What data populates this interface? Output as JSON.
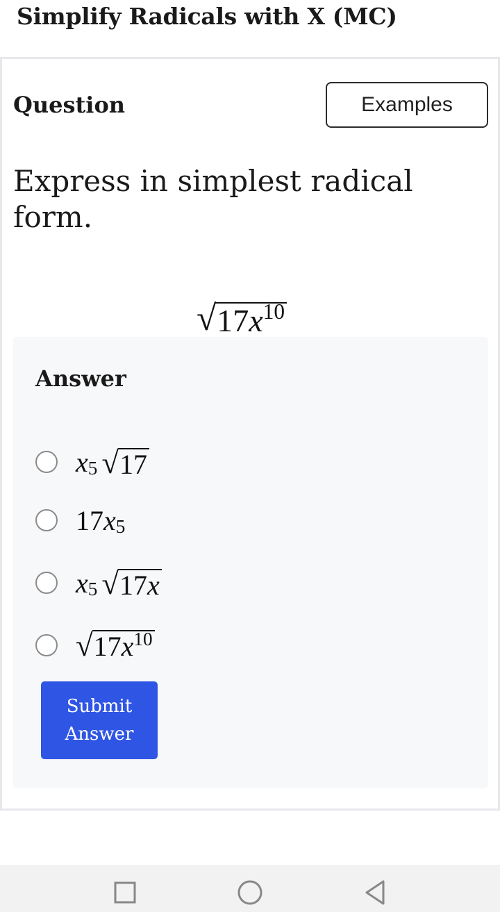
{
  "header": {
    "title": "Simplify Radicals with X (MC)"
  },
  "question": {
    "label": "Question",
    "examples_label": "Examples",
    "prompt": "Express in simplest radical form.",
    "expression": {
      "radicand_coef": "17",
      "radicand_var": "x",
      "radicand_exp": "10"
    }
  },
  "answer": {
    "label": "Answer",
    "options": [
      {
        "outer_var": "x",
        "outer_exp": "5",
        "radicand_coef": "17",
        "radicand_var": "",
        "radicand_exp": ""
      },
      {
        "coef": "17",
        "var": "x",
        "exp": "5"
      },
      {
        "outer_var": "x",
        "outer_exp": "5",
        "radicand_coef": "17",
        "radicand_var": "x",
        "radicand_exp": ""
      },
      {
        "radicand_coef": "17",
        "radicand_var": "x",
        "radicand_exp": "10"
      }
    ],
    "submit_label_line1": "Submit",
    "submit_label_line2": "Answer"
  },
  "nav": {
    "icons": [
      "square-icon",
      "circle-icon",
      "triangle-back-icon"
    ]
  }
}
